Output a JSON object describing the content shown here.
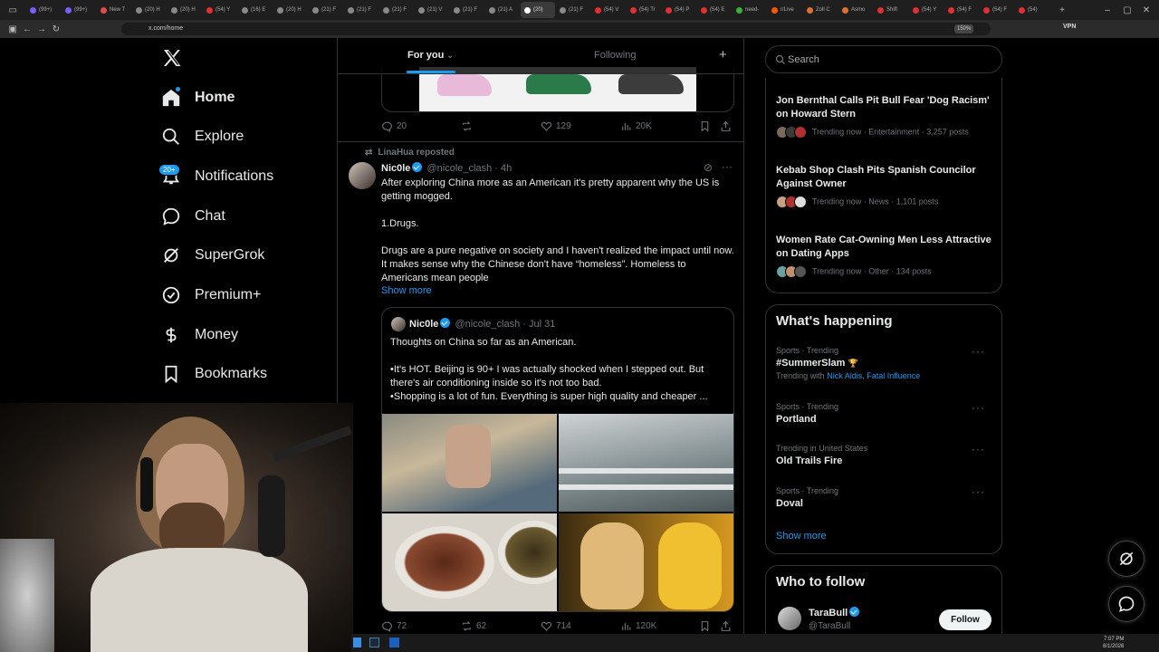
{
  "browser": {
    "tabs": [
      "(99+)",
      "(99+)",
      "New T",
      "(20) H",
      "(20) H",
      "(54) Y",
      "(16) E",
      "(20) H",
      "(21) F",
      "(21) F",
      "(21) F",
      "(21) V",
      "(21) F",
      "(21) A",
      "(20)",
      "(21) F",
      "(54) V",
      "(54) Tr",
      "(54) P",
      "(54) E",
      "need-",
      "r/Live",
      "Zoll C",
      "Asmo",
      "Shift",
      "(54) Y",
      "(54) F",
      "(54) F",
      "(54)"
    ],
    "url": "x.com/home",
    "zoom": "150%",
    "vpn": "VPN"
  },
  "nav": {
    "items": [
      {
        "label": "Home",
        "icon": "home-icon"
      },
      {
        "label": "Explore",
        "icon": "search-icon"
      },
      {
        "label": "Notifications",
        "icon": "bell-icon",
        "badge": "20+"
      },
      {
        "label": "Chat",
        "icon": "chat-icon"
      },
      {
        "label": "SuperGrok",
        "icon": "grok-icon"
      },
      {
        "label": "Premium+",
        "icon": "premium-icon"
      },
      {
        "label": "Money",
        "icon": "money-icon"
      },
      {
        "label": "Bookmarks",
        "icon": "bookmark-icon"
      }
    ]
  },
  "feed": {
    "tab_for_you": "For you",
    "tab_following": "Following",
    "prev_tweet": {
      "replies": "20",
      "likes": "129",
      "views": "20K"
    },
    "tweet": {
      "reposted_by": "LinaHua reposted",
      "name": "Nic0le",
      "handle": "@nicole_clash",
      "time": "· 4h",
      "text_1": "After exploring China more as an American it's pretty apparent why the US is getting mogged.",
      "text_2": "1.Drugs.",
      "text_3": "Drugs are a pure negative on society and I haven't realized the impact until now. It makes sense why the Chinese don't have “homeless”. Homeless to Americans mean people",
      "show_more": "Show more",
      "quote": {
        "name": "Nic0le",
        "handle": "@nicole_clash",
        "time": "· Jul 31",
        "text_1": "Thoughts on China so far as an American.",
        "text_2": "•It's HOT. Beijing is 90+ I was actually shocked when I stepped out. But there's air conditioning inside so it's not too bad.",
        "text_3": "•Shopping is a lot of fun. Everything is super high quality and cheaper ..."
      },
      "replies": "72",
      "reposts": "62",
      "likes": "714",
      "views": "120K"
    }
  },
  "right": {
    "search_placeholder": "Search",
    "trends": [
      {
        "title": "Jon Bernthal Calls Pit Bull Fear 'Dog Racism' on Howard Stern",
        "meta": "Trending now · Entertainment · 3,257 posts"
      },
      {
        "title": "Kebab Shop Clash Pits Spanish Councilor Against Owner",
        "meta": "Trending now · News · 1,101 posts"
      },
      {
        "title": "Women Rate Cat-Owning Men Less Attractive on Dating Apps",
        "meta": "Trending now · Other · 134 posts"
      }
    ],
    "happening": {
      "title": "What's happening",
      "items": [
        {
          "cat": "Sports · Trending",
          "name": "#SummerSlam",
          "with_label": "Trending with",
          "with_links": "Nick Aldis, Fatal Influence"
        },
        {
          "cat": "Sports · Trending",
          "name": "Portland"
        },
        {
          "cat": "Trending in United States",
          "name": "Old Trails Fire"
        },
        {
          "cat": "Sports · Trending",
          "name": "Doval"
        }
      ],
      "show_more": "Show more"
    },
    "who_to_follow": {
      "title": "Who to follow",
      "name": "TaraBull",
      "handle": "@TaraBull",
      "follow_label": "Follow"
    }
  },
  "taskbar": {
    "time": "7:07 PM",
    "date": "8/1/2026"
  },
  "colors": {
    "accent": "#1d9bf0",
    "border": "#2f3336",
    "muted": "#71767b"
  }
}
